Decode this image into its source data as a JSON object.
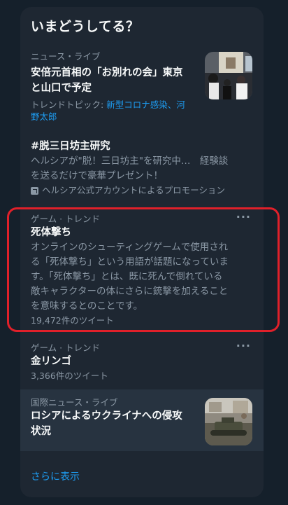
{
  "header": {
    "title": "いまどうしてる？"
  },
  "trends": [
    {
      "meta": "ニュース・ライブ",
      "title_line1": "安倍元首相の「お別れの会」東京",
      "title_line2": "と山口で予定",
      "topic_prefix": "トレンドトピック: ",
      "topic_line1": "新型コロナ感染、河",
      "topic_line2": "野太郎"
    },
    {
      "title": "#脱三日坊主研究",
      "desc_line1": "ヘルシアが\"脱！三日坊主\"を研究中…　経験談",
      "desc_line2": "を送るだけで豪華プレゼント！",
      "promo": "ヘルシア公式アカウントによるプロモーション"
    },
    {
      "meta": "ゲーム · トレンド",
      "title": "死体撃ち",
      "desc_lines": [
        "オンラインのシューティングゲームで使用され",
        "る「死体撃ち」という用語が話題になっていま",
        "す。「死体撃ち」とは、既に死んで倒れている",
        "敵キャラクターの体にさらに銃撃を加えること",
        "を意味するとのことです。"
      ],
      "count": "19,472件のツイート",
      "more": "···"
    },
    {
      "meta": "ゲーム · トレンド",
      "title": "金リンゴ",
      "count": "3,366件のツイート",
      "more": "···"
    },
    {
      "meta": "国際ニュース・ライブ",
      "title_line1": "ロシアによるウクライナへの侵攻",
      "title_line2": "状況"
    }
  ],
  "footer": {
    "show_more": "さらに表示"
  },
  "colors": {
    "accent": "#1d9bf0",
    "highlight_border": "#e0202a"
  }
}
